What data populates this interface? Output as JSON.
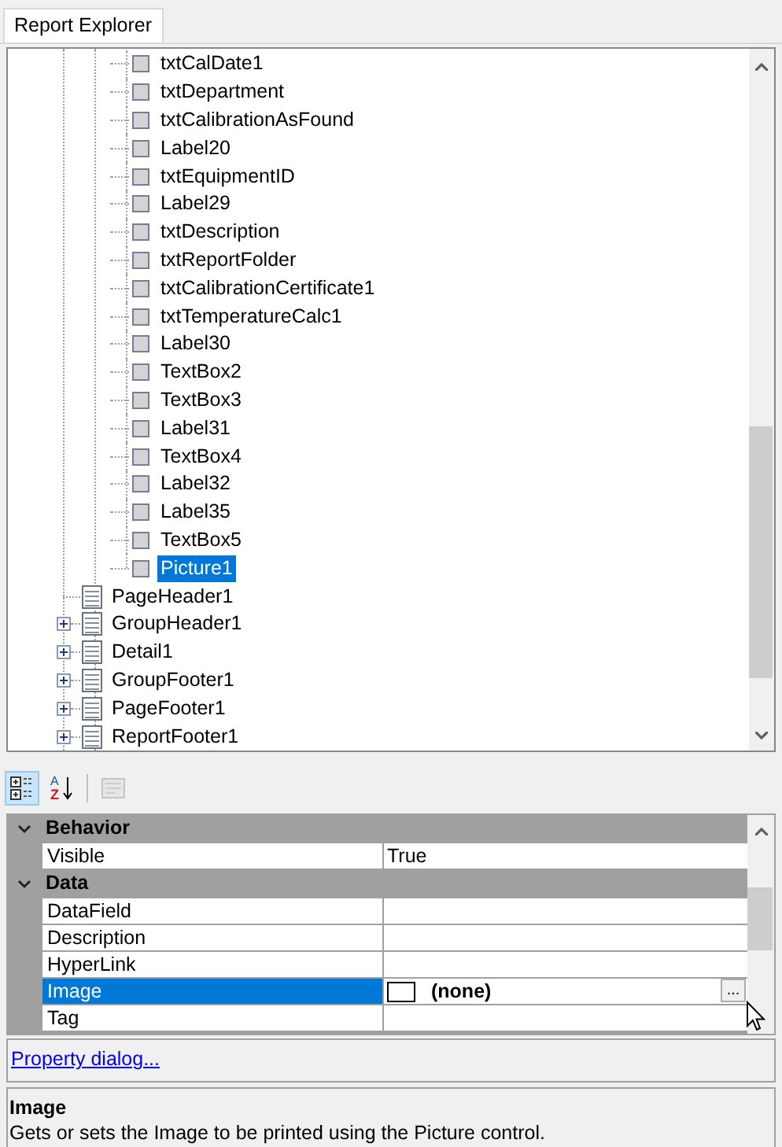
{
  "tabs": [
    {
      "label": "Report Explorer",
      "selected": true
    }
  ],
  "tree": {
    "nested_items": [
      {
        "label": "txtCalDate1",
        "selected": false
      },
      {
        "label": "txtDepartment",
        "selected": false
      },
      {
        "label": "txtCalibrationAsFound",
        "selected": false
      },
      {
        "label": "Label20",
        "selected": false
      },
      {
        "label": "txtEquipmentID",
        "selected": false
      },
      {
        "label": "Label29",
        "selected": false
      },
      {
        "label": "txtDescription",
        "selected": false
      },
      {
        "label": "txtReportFolder",
        "selected": false
      },
      {
        "label": "txtCalibrationCertificate1",
        "selected": false
      },
      {
        "label": "txtTemperatureCalc1",
        "selected": false
      },
      {
        "label": "Label30",
        "selected": false
      },
      {
        "label": "TextBox2",
        "selected": false
      },
      {
        "label": "TextBox3",
        "selected": false
      },
      {
        "label": "Label31",
        "selected": false
      },
      {
        "label": "TextBox4",
        "selected": false
      },
      {
        "label": "Label32",
        "selected": false
      },
      {
        "label": "Label35",
        "selected": false
      },
      {
        "label": "TextBox5",
        "selected": false
      },
      {
        "label": "Picture1",
        "selected": true
      }
    ],
    "items": [
      {
        "label": "PageHeader1",
        "selected": false,
        "expandable": false
      },
      {
        "label": "GroupHeader1",
        "selected": false,
        "expandable": true
      },
      {
        "label": "Detail1",
        "selected": false,
        "expandable": true
      },
      {
        "label": "GroupFooter1",
        "selected": false,
        "expandable": true
      },
      {
        "label": "PageFooter1",
        "selected": false,
        "expandable": true
      },
      {
        "label": "ReportFooter1",
        "selected": false,
        "expandable": true
      }
    ]
  },
  "toolbar": [
    {
      "kind": "categorized",
      "selected": true,
      "disabled": false
    },
    {
      "kind": "alphabetical",
      "selected": false,
      "disabled": false,
      "glyphs": [
        "A",
        "Z"
      ]
    },
    {
      "kind": "pages",
      "selected": false,
      "disabled": true
    }
  ],
  "properties": [
    {
      "category": "Behavior",
      "expanded": true,
      "rows": [
        {
          "name": "Visible",
          "value": "True",
          "selected": false
        }
      ]
    },
    {
      "category": "Data",
      "expanded": true,
      "rows": [
        {
          "name": "DataField",
          "selected": false
        },
        {
          "name": "Description",
          "selected": false
        },
        {
          "name": "HyperLink",
          "selected": false
        },
        {
          "name": "Image",
          "value": "(none)",
          "selected": true,
          "swatch": true,
          "ellipsis": "..."
        },
        {
          "name": "Tag",
          "selected": false
        }
      ]
    }
  ],
  "link": "Property dialog...",
  "description": {
    "title": "Image",
    "text": "Gets or sets the Image to be printed using the Picture control."
  }
}
